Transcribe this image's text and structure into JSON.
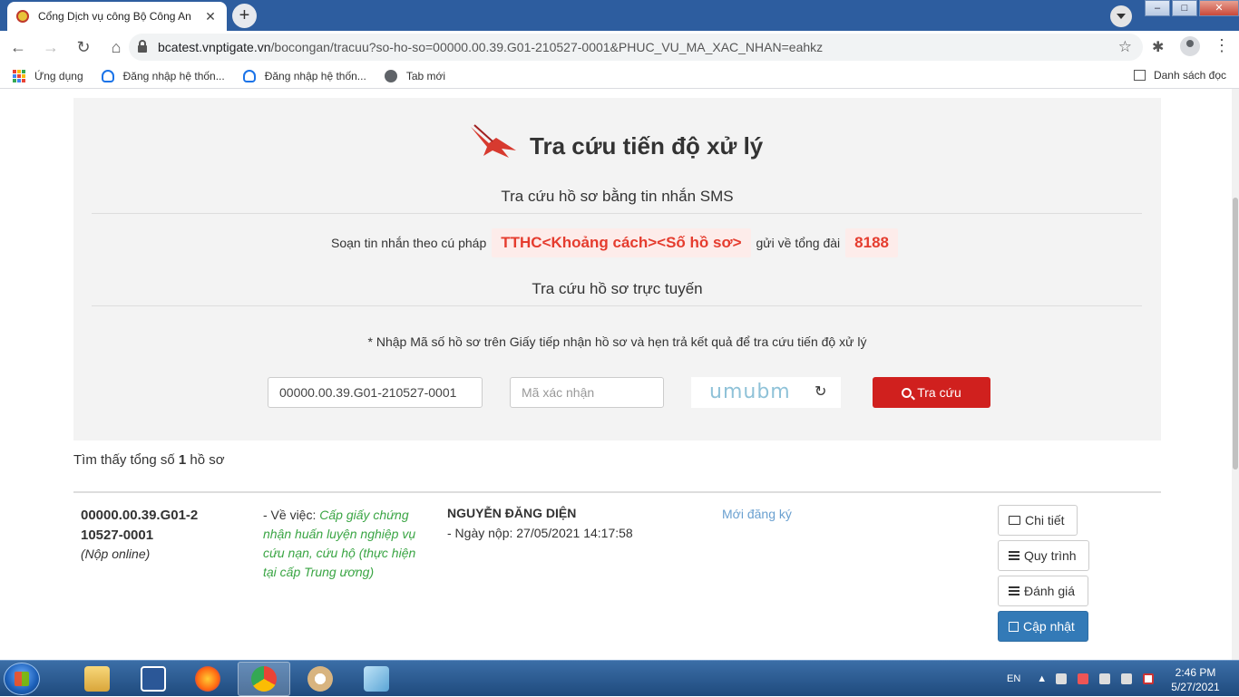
{
  "browser": {
    "tab_title": "Cổng Dịch vụ công Bộ Công An",
    "url_host": "bcatest.vnptigate.vn",
    "url_path": "/bocongan/tracuu?so-ho-so=00000.00.39.G01-210527-0001&PHUC_VU_MA_XAC_NHAN=eahkz",
    "bookmarks": [
      "Ứng dụng",
      "Đăng nhập hệ thốn...",
      "Đăng nhập hệ thốn...",
      "Tab mới"
    ],
    "reading_list": "Danh sách đọc"
  },
  "page": {
    "heading": "Tra cứu tiến độ xử lý",
    "sms_title": "Tra cứu hồ sơ bằng tin nhắn SMS",
    "sms_prefix": "Soạn tin nhắn theo cú pháp",
    "sms_syntax": "TTHC<Khoảng cách><Số hồ sơ>",
    "sms_middle": "gửi về tổng đài",
    "sms_number": "8188",
    "online_title": "Tra cứu hồ sơ trực tuyến",
    "note": "* Nhập Mã số hồ sơ trên Giấy tiếp nhận hồ sơ và hẹn trả kết quả để tra cứu tiến độ xử lý",
    "dossier_value": "00000.00.39.G01-210527-0001",
    "captcha_placeholder": "Mã xác nhận",
    "captcha_text": "umubm",
    "search_label": "Tra cứu",
    "found_prefix": "Tìm thấy tổng số",
    "found_count": "1",
    "found_suffix": "hồ sơ"
  },
  "record": {
    "id": "00000.00.39.G01-210527-0001",
    "channel": "(Nộp online)",
    "about_label": "- Về việc:",
    "about_text": "Cấp giấy chứng nhận huấn luyện nghiệp vụ cứu nạn, cứu hộ (thực hiện tại cấp Trung ương)",
    "applicant": "NGUYỄN ĐĂNG DIỆN",
    "submit_date": "- Ngày nộp: 27/05/2021 14:17:58",
    "status": "Mới đăng ký",
    "actions": [
      "Chi tiết",
      "Quy trình",
      "Đánh giá",
      "Cập nhật"
    ]
  },
  "taskbar": {
    "lang": "EN",
    "time": "2:46 PM",
    "date": "5/27/2021"
  },
  "colors": {
    "accent_red": "#d0201e",
    "syntax_red": "#e53c2e",
    "green": "#3aa544",
    "primary_blue": "#337ab7"
  }
}
